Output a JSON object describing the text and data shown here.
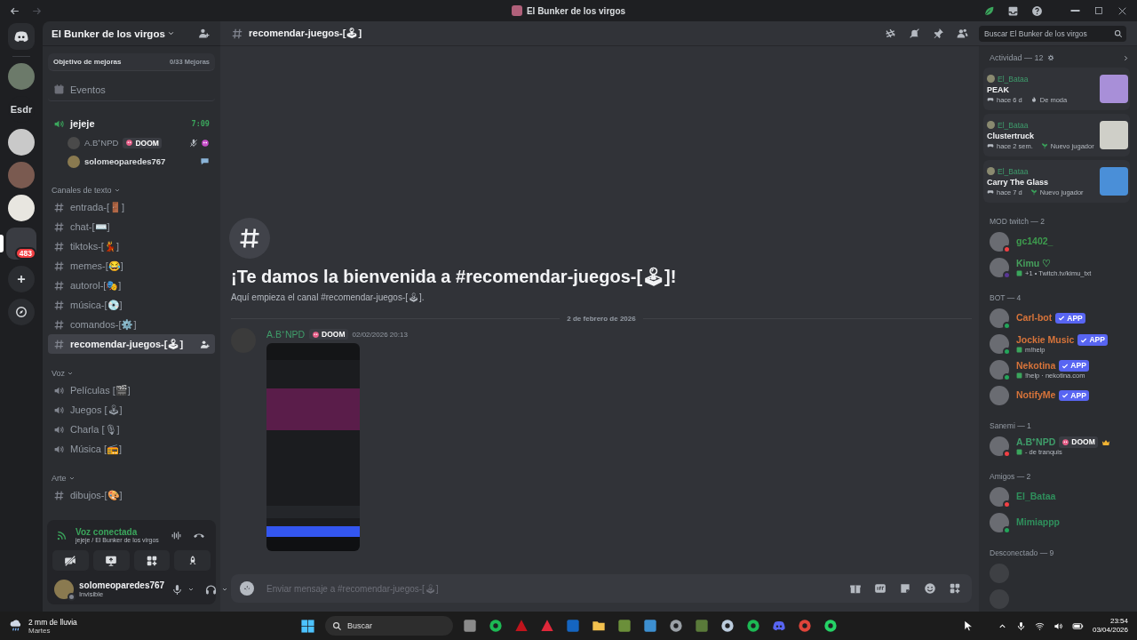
{
  "window": {
    "title": "El Bunker de los virgos"
  },
  "servers": [
    {
      "kind": "home"
    },
    {
      "kind": "avatar"
    },
    {
      "kind": "text",
      "label": "Esdr"
    },
    {
      "kind": "avatar"
    },
    {
      "kind": "avatar"
    },
    {
      "kind": "avatar"
    },
    {
      "kind": "folder",
      "badge": "483"
    },
    {
      "kind": "add"
    },
    {
      "kind": "explore"
    }
  ],
  "server": {
    "name": "El Bunker de los virgos"
  },
  "boost": {
    "label": "Objetivo de mejoras",
    "progress": "0/33 Mejoras"
  },
  "events": "Eventos",
  "voice_session": {
    "channel": "jejeje",
    "timer": "7:09",
    "members": [
      {
        "name": "A.B⁺NPD",
        "tag": "DOOM",
        "muted": true
      },
      {
        "name": "solomeoparedes767",
        "muted": false
      }
    ]
  },
  "categories": [
    {
      "name": "Canales de texto",
      "channels": [
        {
          "kind": "text",
          "name": "entrada-[🚪]",
          "selected": false
        },
        {
          "kind": "text",
          "name": "chat-[⌨️]",
          "selected": false
        },
        {
          "kind": "text",
          "name": "tiktoks-[💃]",
          "selected": false
        },
        {
          "kind": "text",
          "name": "memes-[😂]",
          "selected": false
        },
        {
          "kind": "text",
          "name": "autorol-[🎭]",
          "selected": false
        },
        {
          "kind": "text",
          "name": "música-[💿]",
          "selected": false
        },
        {
          "kind": "text",
          "name": "comandos-[⚙️]",
          "selected": false
        },
        {
          "kind": "text",
          "name": "recomendar-juegos-[🕹]",
          "selected": true
        }
      ]
    },
    {
      "name": "Voz",
      "channels": [
        {
          "kind": "voice",
          "name": "Películas [🎬]",
          "selected": false
        },
        {
          "kind": "voice",
          "name": "Juegos [🕹]",
          "selected": false
        },
        {
          "kind": "voice",
          "name": "Charla [🎙]",
          "selected": false
        },
        {
          "kind": "voice",
          "name": "Música [📻]",
          "selected": false
        }
      ]
    },
    {
      "name": "Arte",
      "channels": [
        {
          "kind": "text",
          "name": "dibujos-[🎨]",
          "selected": false
        }
      ]
    }
  ],
  "voice_panel": {
    "status": "Voz conectada",
    "location": "jejeje / El Bunker de los virgos"
  },
  "user_panel": {
    "name": "solomeoparedes767",
    "status": "Invisible",
    "status_dot": {
      "color": "#80848e"
    }
  },
  "channel": {
    "name": "recomendar-juegos-[🕹]"
  },
  "search": {
    "placeholder": "Buscar El Bunker de los virgos"
  },
  "welcome": {
    "title": "¡Te damos la bienvenida a #recomendar-juegos-[🕹]!",
    "subtitle": "Aquí empieza el canal #recomendar-juegos-[🕹]."
  },
  "date_divider": "2 de febrero de 2026",
  "messages": [
    {
      "author": "A.B⁺NPD",
      "color": "#3f9d6a",
      "tag": "DOOM",
      "time": "02/02/2026 20:13"
    }
  ],
  "composer": {
    "placeholder": "Enviar mensaje a #recomendar-juegos-[🕹]"
  },
  "activity": {
    "title": "Actividad — 12",
    "cards": [
      {
        "user": "El_Bataa",
        "game": "PEAK",
        "ago": "hace 6 d",
        "kind": "trending",
        "badge": "De moda"
      },
      {
        "user": "El_Bataa",
        "game": "Clustertruck",
        "ago": "hace 2 sem.",
        "kind": "new",
        "badge": "Nuevo jugador"
      },
      {
        "user": "El_Bataa",
        "game": "Carry The Glass",
        "ago": "hace 7 d",
        "kind": "new",
        "badge": "Nuevo jugador"
      }
    ]
  },
  "groups": [
    {
      "title": "MOD twitch — 2",
      "members": [
        {
          "name": "gc1402_",
          "color": "#3e9c4e",
          "status_dot": {
            "color": "#f23f43"
          }
        },
        {
          "name": "Kimu ♡",
          "color": "#46a05c",
          "status_dot": {
            "color": "#593695"
          },
          "activity": "+1 • Twitch.tv/kimu_txt"
        }
      ]
    },
    {
      "title": "BOT — 4",
      "members": [
        {
          "name": "Carl-bot",
          "color": "#d8743a",
          "status_dot": {
            "color": "#23a55a"
          },
          "tag": "APP"
        },
        {
          "name": "Jockie Music",
          "color": "#d8743a",
          "status_dot": {
            "color": "#23a55a"
          },
          "tag": "APP",
          "activity": "m!help"
        },
        {
          "name": "Nekotina",
          "color": "#d8743a",
          "status_dot": {
            "color": "#23a55a"
          },
          "tag": "APP",
          "activity": "!help · nekotina.com"
        },
        {
          "name": "NotifyMe",
          "color": "#d8743a",
          "tag": "APP"
        }
      ]
    },
    {
      "title": "Sanemi — 1",
      "members": [
        {
          "name": "A.B⁺NPD",
          "color": "#3f9d6a",
          "status_dot": {
            "color": "#f23f43"
          },
          "clan": "DOOM",
          "owner": true,
          "activity": "- de tranquis"
        }
      ]
    },
    {
      "title": "Amigos — 2",
      "members": [
        {
          "name": "El_Bataa",
          "color": "#2f8f5c",
          "status_dot": {
            "color": "#f23f43"
          }
        },
        {
          "name": "Mimiappp",
          "color": "#2f8f5c",
          "status_dot": {
            "color": "#23a55a"
          }
        }
      ]
    },
    {
      "title": "Desconectado — 9",
      "members": [
        {
          "offline": true
        },
        {
          "offline": true
        }
      ]
    }
  ],
  "taskbar": {
    "weather": "2 mm de lluvia",
    "day": "Martes",
    "search": "Buscar",
    "time": "23:54",
    "date": "03/04/2026"
  }
}
